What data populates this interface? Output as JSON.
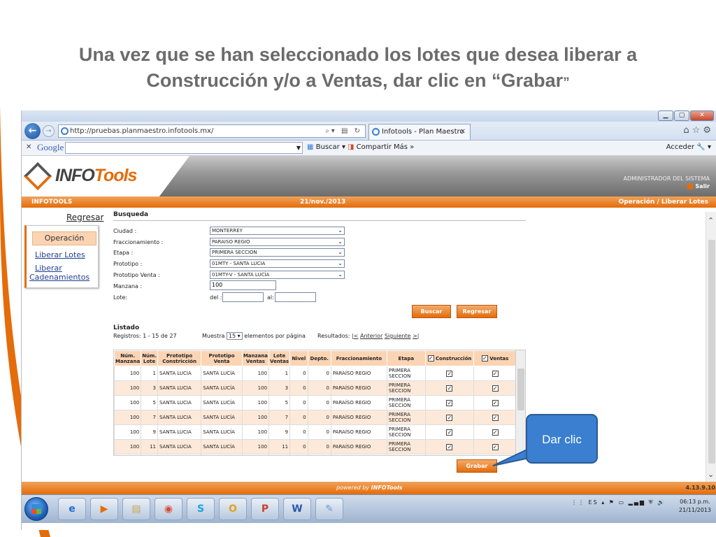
{
  "slide": {
    "title_line1": "Una vez que se han seleccionado los lotes que desea liberar a",
    "title_line2": "Construcción y/o a Ventas, dar clic en “Grabar",
    "title_quote": "”",
    "callout": "Dar clic"
  },
  "browser": {
    "url": "http://pruebas.planmaestro.infotools.mx/",
    "tab_title": "Infotools - Plan Maestro",
    "toolbar": {
      "google": "Google",
      "buscar": "Buscar",
      "compartir": "Compartir",
      "mas": "Más »",
      "acceder": "Acceder"
    }
  },
  "app": {
    "logo_info": "INFO",
    "logo_tools": "Tools",
    "user_role": "ADMINISTRADOR DEL SISTEMA",
    "logout": "Salir",
    "status_left": "INFOTOOLS",
    "status_date": "21/nov./2013",
    "status_right": "Operación / Liberar Lotes",
    "regresar_link": "Regresar",
    "menu": {
      "header": "Operación",
      "item1": "Liberar Lotes",
      "item2a": "Liberar",
      "item2b": "Cadenamientos"
    },
    "form": {
      "section": "Busqueda",
      "ciudad_label": "Ciudad :",
      "ciudad": "MONTERREY",
      "fracc_label": "Fraccionamiento :",
      "fracc": "PARAISO REGIO",
      "etapa_label": "Etapa :",
      "etapa": "PRIMERA SECCION",
      "prototipo_label": "Prototipo :",
      "prototipo": "01MTY - SANTA LUCIA",
      "protoventa_label": "Prototipo Venta :",
      "protoventa": "01MTY-V - SANTA LUCÍA",
      "manzana_label": "Manzana :",
      "manzana": "100",
      "lote_label": "Lote:",
      "del_label": "del :",
      "al_label": "al:",
      "buscar_btn": "Buscar",
      "regresar_btn": "Regresar"
    },
    "list": {
      "title": "Listado",
      "registros": "Registros: 1 - 15 de 27",
      "muestra": "Muestra",
      "page_size": "15",
      "elementos": "elementos por página",
      "resultados": "Resultados:",
      "first": "|<",
      "prev": "Anterior",
      "next": "Siguiente",
      "last": ">|"
    },
    "table": {
      "headers": [
        "Núm. Manzana",
        "Núm. Lote",
        "Prototipo Constricción",
        "Prototipo Venta",
        "Manzana Ventas",
        "Lote Ventas",
        "Nivel",
        "Depto.",
        "Fraccionamiento",
        "Etapa",
        "Construcción",
        "Ventas"
      ],
      "rows": [
        [
          "100",
          "1",
          "SANTA LUCIA",
          "SANTA LUCÍA",
          "100",
          "1",
          "0",
          "0",
          "PARAÍSO REGIO",
          "PRIMERA SECCION"
        ],
        [
          "100",
          "3",
          "SANTA LUCIA",
          "SANTA LUCÍA",
          "100",
          "3",
          "0",
          "0",
          "PARAÍSO REGIO",
          "PRIMERA SECCION"
        ],
        [
          "100",
          "5",
          "SANTA LUCIA",
          "SANTA LUCÍA",
          "100",
          "5",
          "0",
          "0",
          "PARAÍSO REGIO",
          "PRIMERA SECCION"
        ],
        [
          "100",
          "7",
          "SANTA LUCIA",
          "SANTA LUCÍA",
          "100",
          "7",
          "0",
          "0",
          "PARAÍSO REGIO",
          "PRIMERA SECCION"
        ],
        [
          "100",
          "9",
          "SANTA LUCIA",
          "SANTA LUCÍA",
          "100",
          "9",
          "0",
          "0",
          "PARAÍSO REGIO",
          "PRIMERA SECCION"
        ],
        [
          "100",
          "11",
          "SANTA LUCIA",
          "SANTA LUCÍA",
          "100",
          "11",
          "0",
          "0",
          "PARAÍSO REGIO",
          "PRIMERA SECCION"
        ],
        [
          "",
          "",
          "",
          "",
          "",
          "",
          "",
          "",
          "",
          "PRIMERA"
        ]
      ],
      "check": "✓"
    },
    "grabar_btn": "Grabar",
    "footer_powered": "powered by",
    "footer_brand": "INFOTools",
    "version": "4.13.9.10"
  },
  "taskbar": {
    "lang": "ES",
    "time": "06:13 p.m.",
    "date": "21/11/2013",
    "apps": [
      "e",
      "▶",
      "▤",
      "◉",
      "S",
      "O",
      "P",
      "W",
      "✎"
    ]
  },
  "colors": {
    "accent": "#e46c0a",
    "callout": "#3a7fd0",
    "row_alt": "#fde9d9",
    "header": "#fbd4b4"
  }
}
